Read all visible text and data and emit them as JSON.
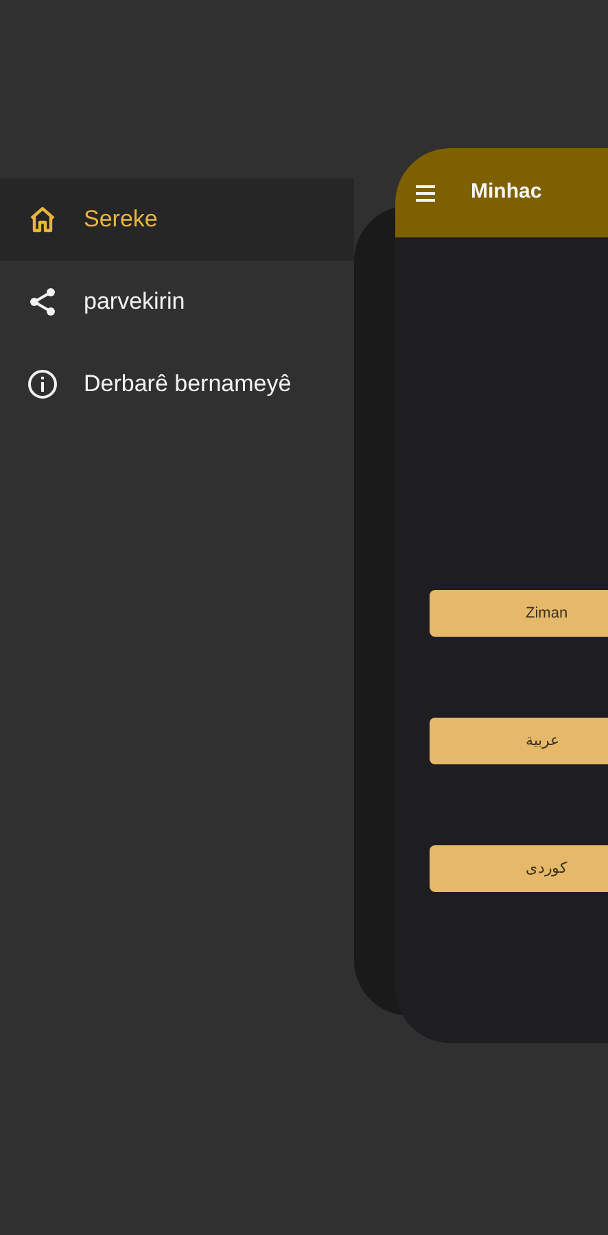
{
  "drawer": {
    "items": [
      {
        "kind": "home",
        "label": "Sereke",
        "selected": true
      },
      {
        "kind": "share",
        "label": "parvekirin",
        "selected": false
      },
      {
        "kind": "info",
        "label": "Derbarê bernameyê",
        "selected": false
      }
    ]
  },
  "app": {
    "title": "Minhac",
    "buttons": [
      {
        "label": "Ziman"
      },
      {
        "label": "عربية"
      },
      {
        "label": "کوردی"
      }
    ]
  }
}
